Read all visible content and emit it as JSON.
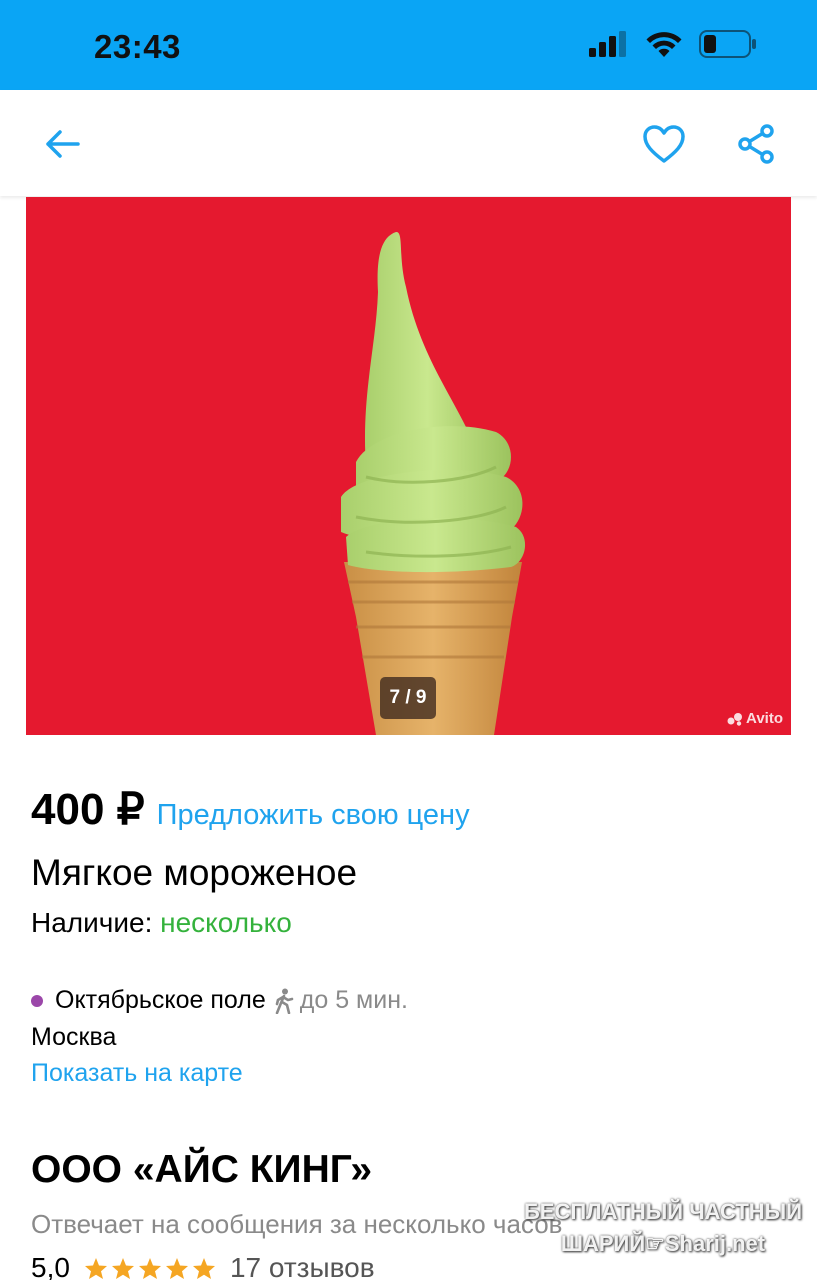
{
  "status_bar": {
    "time": "23:43",
    "background": "#0aa5f5",
    "icons": [
      "signal-icon",
      "wifi-icon",
      "battery-icon"
    ]
  },
  "nav": {
    "icons": [
      "back-arrow-icon",
      "heart-icon",
      "share-icon"
    ],
    "accent": "#1fa3ee"
  },
  "gallery": {
    "counter": "7 / 9",
    "watermark": "Avito",
    "background": "#e5192f"
  },
  "listing": {
    "price": "400 ₽",
    "offer_link": "Предложить свою цену",
    "title": "Мягкое мороженое",
    "availability_label": "Наличие:",
    "availability_value": "несколько",
    "metro_station": "Октябрьское поле",
    "walk_time": "до 5 мин.",
    "city": "Москва",
    "map_link": "Показать на карте"
  },
  "seller": {
    "name": "ООО «АЙС КИНГ»",
    "response": "Отвечает на сообщения за несколько часов",
    "rating": "5,0",
    "stars": 5,
    "reviews": "17 отзывов"
  },
  "overlay_watermark": {
    "line1": "БЕСПЛАТНЫЙ ЧАСТНЫЙ",
    "line2": "ШАРИЙ☞Sharij.net"
  },
  "colors": {
    "link": "#1fa3ee",
    "availability": "#34b23c",
    "metro_line": "#9b47a9",
    "star": "#f5a623"
  }
}
